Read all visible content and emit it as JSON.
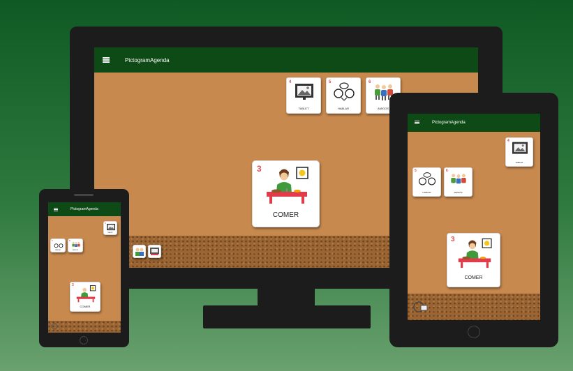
{
  "app": {
    "title": "PictogramAgenda"
  },
  "colors": {
    "appbar": "#0d4a15",
    "background_top": "#0f5a24",
    "device": "#1c1c1c",
    "number": "#e05050"
  },
  "monitor": {
    "cards": [
      {
        "num": "4",
        "label": "TABLET",
        "icon": "tablet-picture-icon"
      },
      {
        "num": "5",
        "label": "HABLAR",
        "icon": "talking-people-icon"
      },
      {
        "num": "6",
        "label": "AMIGOS",
        "icon": "friends-icon"
      }
    ],
    "current": {
      "num": "3",
      "label": "COMER",
      "icon": "eating-person-icon"
    }
  },
  "tablet": {
    "cards": [
      {
        "num": "4",
        "label": "TABLET"
      },
      {
        "num": "5",
        "label": "HABLAR"
      },
      {
        "num": "6",
        "label": "AMIGOS"
      }
    ],
    "current": {
      "num": "3",
      "label": "COMER"
    }
  },
  "phone": {
    "cards": [
      {
        "num": "4",
        "label": "TABLET"
      },
      {
        "num": "5",
        "label": "HABLAR"
      },
      {
        "num": "6",
        "label": "AMIGOS"
      }
    ],
    "current": {
      "num": "3",
      "label": "COMER"
    }
  }
}
